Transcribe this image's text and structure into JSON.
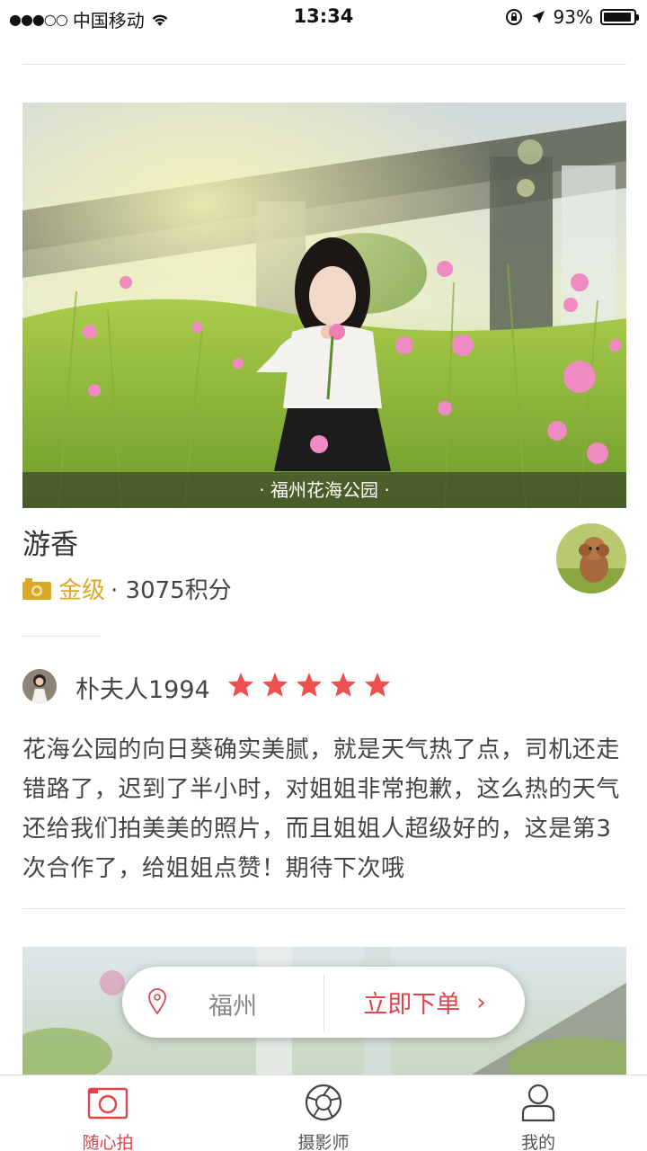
{
  "status": {
    "carrier": "中国移动",
    "time": "13:34",
    "battery": "93%",
    "battery_level": 0.93
  },
  "card": {
    "photo_caption": "· 福州花海公园 ·",
    "photographer_name": "游香",
    "rank_label": "金级",
    "points": "· 3075积分"
  },
  "review": {
    "user": "朴夫人1994",
    "rating": 5,
    "text": "花海公园的向日葵确实美腻，就是天气热了点，司机还走错路了，迟到了半小时，对姐姐非常抱歉，这么热的天气还给我们拍美美的照片，而且姐姐人超级好的，这是第3次合作了，给姐姐点赞！期待下次哦"
  },
  "order_bar": {
    "city": "福州",
    "order_label": "立即下单",
    "chevron": "›"
  },
  "tabs": [
    {
      "label": "随心拍",
      "icon": "camera-icon",
      "active": true
    },
    {
      "label": "摄影师",
      "icon": "aperture-icon",
      "active": false
    },
    {
      "label": "我的",
      "icon": "user-icon",
      "active": false
    }
  ],
  "colors": {
    "accent": "#e0454b",
    "gold": "#d9a928",
    "star": "#ec5150"
  }
}
